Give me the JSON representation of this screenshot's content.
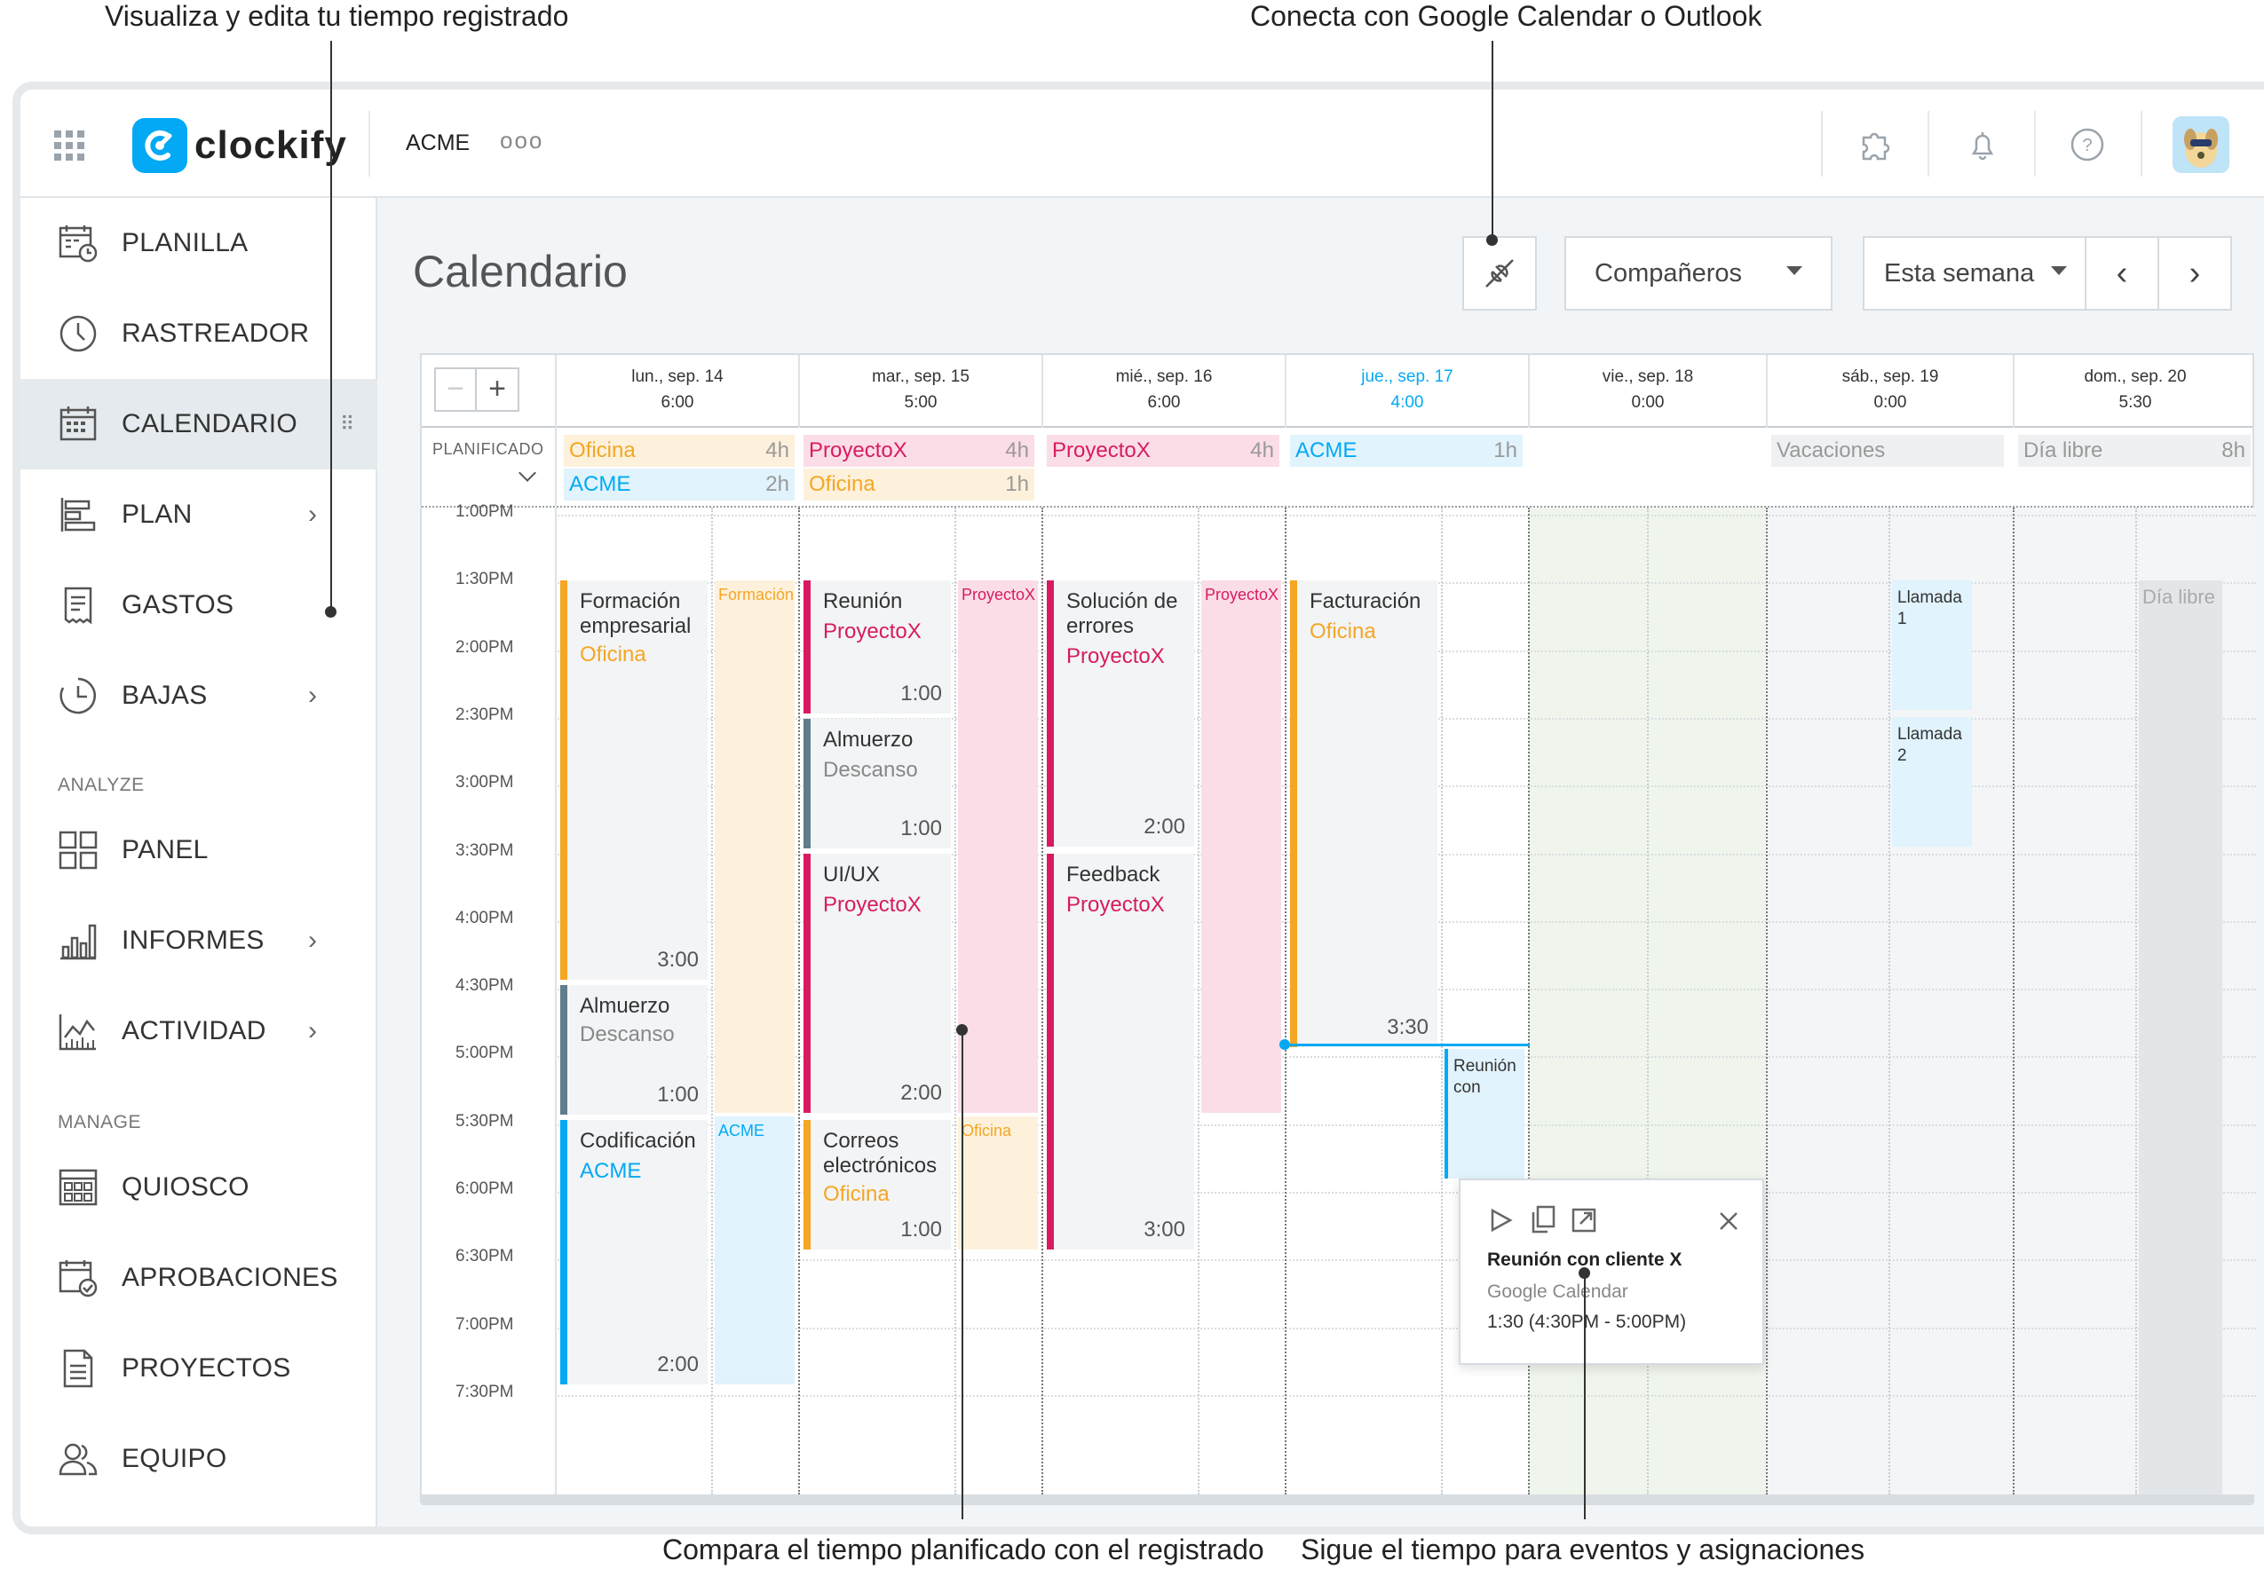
{
  "annotations": {
    "top_left": "Visualiza y edita tu tiempo registrado",
    "top_right": "Conecta con Google Calendar o Outlook",
    "bottom_left": "Compara el tiempo planificado con el registrado",
    "bottom_right": "Sigue el tiempo para eventos y asignaciones"
  },
  "header": {
    "logo_text": "clockify",
    "workspace": "ACME",
    "more": "ooo"
  },
  "sidebar": {
    "items": [
      {
        "label": "PLANILLA",
        "icon": "timesheet-icon"
      },
      {
        "label": "RASTREADOR",
        "icon": "clock-icon"
      },
      {
        "label": "CALENDARIO",
        "icon": "calendar-icon",
        "active": true
      },
      {
        "label": "PLAN",
        "icon": "plan-icon",
        "chevron": true
      },
      {
        "label": "GASTOS",
        "icon": "receipt-icon"
      },
      {
        "label": "BAJAS",
        "icon": "time-off-icon",
        "chevron": true
      }
    ],
    "section_analyze": "ANALYZE",
    "analyze_items": [
      {
        "label": "PANEL",
        "icon": "dashboard-icon"
      },
      {
        "label": "INFORMES",
        "icon": "reports-icon",
        "chevron": true
      },
      {
        "label": "ACTIVIDAD",
        "icon": "activity-icon",
        "chevron": true
      }
    ],
    "section_manage": "MANAGE",
    "manage_items": [
      {
        "label": "QUIOSCO",
        "icon": "kiosk-icon"
      },
      {
        "label": "APROBACIONES",
        "icon": "approvals-icon"
      },
      {
        "label": "PROYECTOS",
        "icon": "projects-icon"
      },
      {
        "label": "EQUIPO",
        "icon": "team-icon"
      }
    ]
  },
  "page": {
    "title": "Calendario",
    "teammates_label": "Compañeros",
    "range_label": "Esta semana"
  },
  "colors": {
    "orange": "#f5a623",
    "pink": "#d81b60",
    "blue": "#03a9f4",
    "gray": "#607d8b",
    "brand": "#03a9f4"
  },
  "calendar": {
    "planned_label": "PLANIFICADO",
    "days": [
      {
        "label": "lun., sep. 14",
        "total": "6:00"
      },
      {
        "label": "mar., sep. 15",
        "total": "5:00"
      },
      {
        "label": "mié., sep. 16",
        "total": "6:00"
      },
      {
        "label": "jue., sep. 17",
        "total": "4:00",
        "today": true
      },
      {
        "label": "vie., sep. 18",
        "total": "0:00"
      },
      {
        "label": "sáb., sep. 19",
        "total": "0:00"
      },
      {
        "label": "dom., sep. 20",
        "total": "5:30"
      }
    ],
    "planned": {
      "mon": [
        {
          "name": "Oficina",
          "hours": "4h"
        },
        {
          "name": "ACME",
          "hours": "2h"
        }
      ],
      "tue": [
        {
          "name": "ProyectoX",
          "hours": "4h"
        },
        {
          "name": "Oficina",
          "hours": "1h"
        }
      ],
      "wed": [
        {
          "name": "ProyectoX",
          "hours": "4h"
        }
      ],
      "thu": [
        {
          "name": "ACME",
          "hours": "1h"
        }
      ],
      "sat": [
        {
          "name": "Vacaciones",
          "hours": ""
        }
      ],
      "sun": [
        {
          "name": "Día libre",
          "hours": "8h"
        }
      ]
    },
    "times": [
      "1:00PM",
      "1:30PM",
      "2:00PM",
      "2:30PM",
      "3:00PM",
      "3:30PM",
      "4:00PM",
      "4:30PM",
      "5:00PM",
      "5:30PM",
      "6:00PM",
      "6:30PM",
      "7:00PM",
      "7:30PM"
    ],
    "events": {
      "mon": [
        {
          "title": "Formación empresarial",
          "project": "Oficina",
          "duration": "3:00"
        },
        {
          "title": "Almuerzo",
          "project": "Descanso",
          "duration": "1:00"
        },
        {
          "title": "Codificación",
          "project": "ACME",
          "duration": "2:00"
        }
      ],
      "mon_plan": [
        "Formación",
        "ACME"
      ],
      "tue": [
        {
          "title": "Reunión",
          "project": "ProyectoX",
          "duration": "1:00"
        },
        {
          "title": "Almuerzo",
          "project": "Descanso",
          "duration": "1:00"
        },
        {
          "title": "UI/UX",
          "project": "ProyectoX",
          "duration": "2:00"
        },
        {
          "title": "Correos electrónicos",
          "project": "Oficina",
          "duration": "1:00"
        }
      ],
      "tue_plan": [
        "ProyectoX",
        "Oficina"
      ],
      "wed": [
        {
          "title": "Solución de errores",
          "project": "ProyectoX",
          "duration": "2:00"
        },
        {
          "title": "Feedback",
          "project": "ProyectoX",
          "duration": "3:00"
        }
      ],
      "wed_plan": [
        "ProyectoX"
      ],
      "thu": [
        {
          "title": "Facturación",
          "project": "Oficina",
          "duration": "3:30"
        }
      ],
      "thu_ext": "Reunión con",
      "sat": [
        "Llamada 1",
        "Llamada 2"
      ],
      "sun_plan": "Día libre"
    },
    "popup": {
      "title": "Reunión con cliente X",
      "source": "Google Calendar",
      "time": "1:30 (4:30PM - 5:00PM)"
    }
  }
}
